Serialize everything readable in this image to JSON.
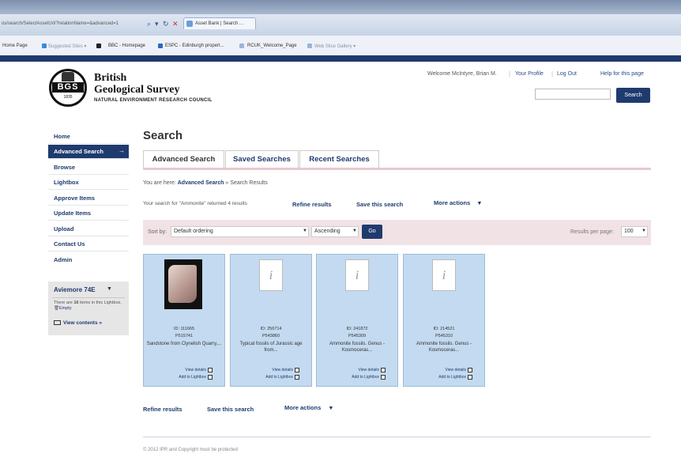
{
  "browser": {
    "url": "os/search/SelectAssetUrl/?relationName=&advanced=1",
    "tab_title": "Asset Bank | Search ...",
    "favorites": [
      "Home Page",
      "Suggested Sites ▾",
      "BBC - Homepage",
      "ESPC - Edinburgh propert...",
      "RCUK_Welcome_Page",
      "Web Slice Gallery ▾"
    ]
  },
  "header": {
    "logo_text": "BGS",
    "logo_year": "1835",
    "brand_line1": "British",
    "brand_line2": "Geological Survey",
    "brand_line3": "NATURAL ENVIRONMENT RESEARCH COUNCIL",
    "welcome": "Welcome McIntyre, Brian M.",
    "your_profile": "Your Profile",
    "log_out": "Log Out",
    "help": "Help for this page",
    "search_placeholder": "",
    "search_button": "Search"
  },
  "sidebar": {
    "items": [
      {
        "label": "Home",
        "active": false
      },
      {
        "label": "Advanced Search",
        "active": true
      },
      {
        "label": "Browse",
        "active": false
      },
      {
        "label": "Lightbox",
        "active": false
      },
      {
        "label": "Approve Items",
        "active": false
      },
      {
        "label": "Update Items",
        "active": false
      },
      {
        "label": "Upload",
        "active": false
      },
      {
        "label": "Contact Us",
        "active": false
      },
      {
        "label": "Admin",
        "active": false
      }
    ],
    "active_arrow": "→",
    "lightbox": {
      "title": "Aviemore 74E",
      "text_pre": "There are ",
      "count": "16",
      "text_post": " items in this Lightbox. ",
      "empty_link": "Empty",
      "view_contents": "View contents »"
    }
  },
  "main": {
    "title": "Search",
    "tabs": [
      "Advanced Search",
      "Saved Searches",
      "Recent Searches"
    ],
    "breadcrumb_pre": "You are here: ",
    "breadcrumb_link": "Advanced Search",
    "breadcrumb_post": " » Search Results",
    "result_summary": "Your search for \"Ammonite\" returned 4 results",
    "actions": {
      "refine": "Refine results",
      "save": "Save this search",
      "more": "More actions"
    },
    "sort_label": "Sort by:",
    "sort_value": "Default ordering",
    "order_value": "Ascending",
    "go": "Go",
    "results_per_page_label": "Results per page:",
    "results_per_page": "100",
    "results": [
      {
        "id": "ID: 111665",
        "ref": "P515741",
        "title": "Sandstone from Clynelish Quarry,...",
        "view": "View details",
        "add": "Add to Lightbox",
        "thumb": "photo"
      },
      {
        "id": "ID: 256714",
        "ref": "P543860",
        "title": "Typical fossils of Jurassic age from...",
        "view": "View details",
        "add": "Add to Lightbox",
        "thumb": "placeholder"
      },
      {
        "id": "ID: 241872",
        "ref": "P545309",
        "title": "Ammonite fossils. Genus - Kosmoceras...",
        "view": "View details",
        "add": "Add to Lightbox",
        "thumb": "placeholder"
      },
      {
        "id": "ID: 214521",
        "ref": "P545310",
        "title": "Ammonite fossils. Genus - Kosmoceras...",
        "view": "View details",
        "add": "Add to Lightbox",
        "thumb": "placeholder"
      }
    ],
    "footer": "© 2012 IPR and Copyright must be protected"
  }
}
